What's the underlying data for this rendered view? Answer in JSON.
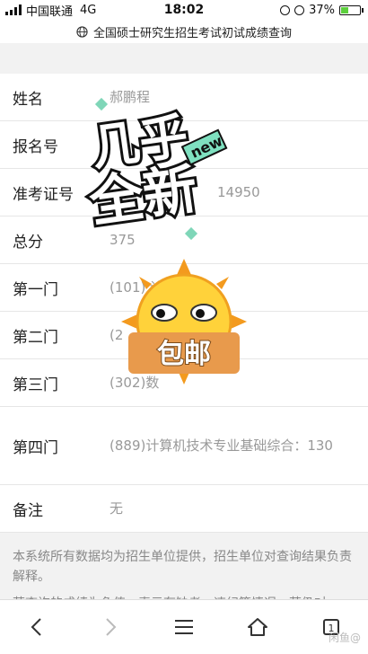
{
  "status": {
    "carrier": "中国联通",
    "network": "4G",
    "time": "18:02",
    "battery": "37%",
    "battery_level": 0.37
  },
  "url_bar": {
    "title": "全国硕士研究生招生考试初试成绩查询"
  },
  "rows": [
    {
      "label": "姓名",
      "value": "郝鹏程"
    },
    {
      "label": "报名号",
      "value": ""
    },
    {
      "label": "准考证号",
      "value": "14950"
    },
    {
      "label": "总分",
      "value": "375"
    },
    {
      "label": "第一门",
      "value": "(101)  论：58"
    },
    {
      "label": "第二门",
      "value": "(2"
    },
    {
      "label": "第三门",
      "value": "(302)数"
    },
    {
      "label": "第四门",
      "value": "(889)计算机技术专业基础综合：130"
    },
    {
      "label": "备注",
      "value": "无"
    }
  ],
  "notes": [
    "本系统所有数据均为招生单位提供，招生单位对查询结果负责解释。",
    "若查询的成绩为负值，表示有缺考、违纪等情况。若仍对"
  ],
  "stickers": {
    "main": "几乎全新",
    "badge": "new",
    "tag": "包邮"
  },
  "watermark": "闲鱼@"
}
